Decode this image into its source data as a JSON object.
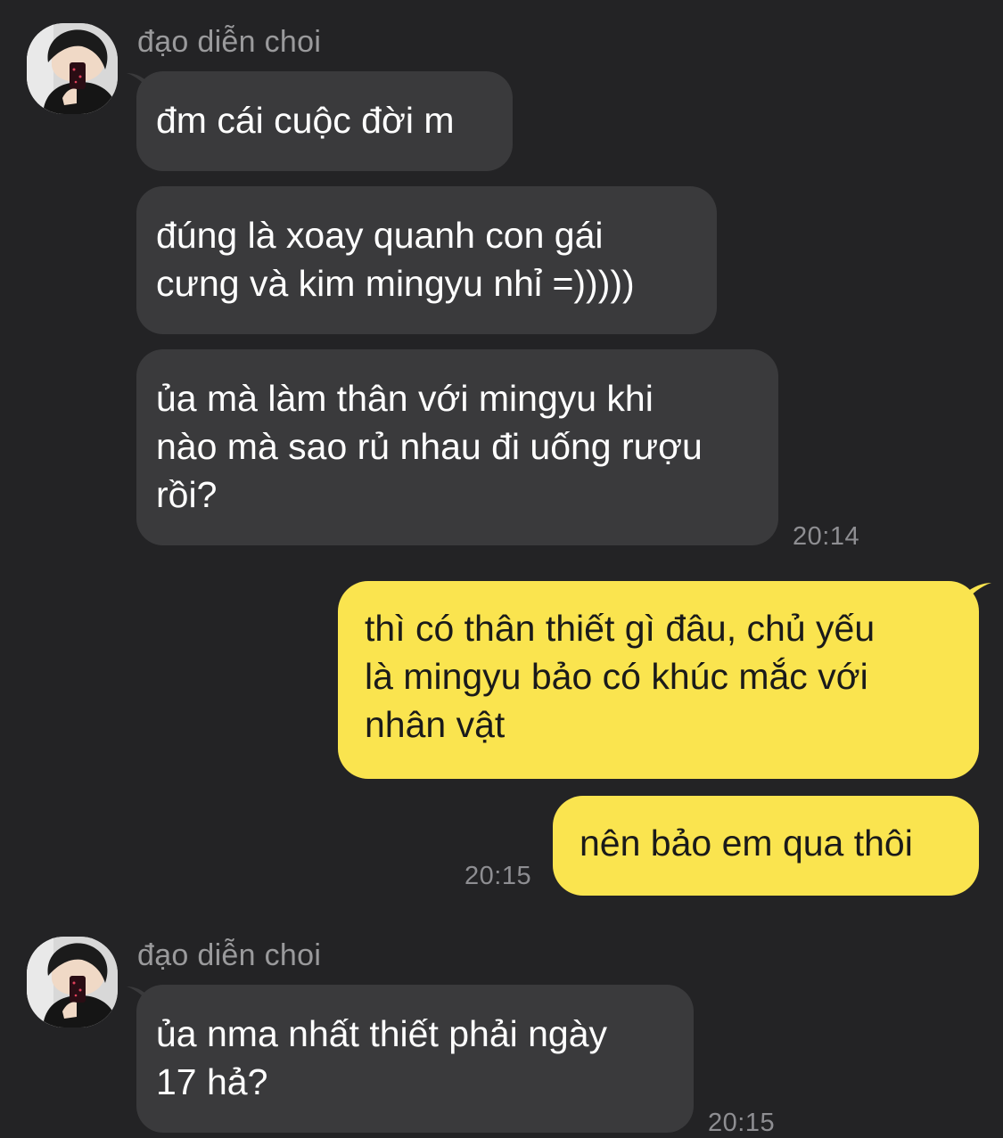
{
  "conversation": {
    "groups": [
      {
        "sender": "đạo diễn choi",
        "messages": [
          "đm cái cuộc đời m",
          "đúng là xoay quanh con gái\ncưng và kim mingyu nhỉ =)))))",
          "ủa mà làm thân với mingyu khi\nnào mà sao rủ nhau đi uống rượu\nrồi?"
        ],
        "time": "20:14"
      },
      {
        "sender": "me",
        "messages": [
          "thì có thân thiết gì đâu, chủ yếu\nlà mingyu bảo có khúc mắc với\nnhân vật",
          "nên bảo em qua thôi"
        ],
        "time": "20:15"
      },
      {
        "sender": "đạo diễn choi",
        "messages": [
          "ủa nma nhất thiết phải ngày\n17 hả?"
        ],
        "time": "20:15"
      }
    ]
  },
  "colors": {
    "background": "#232325",
    "incoming_bubble": "#3a3a3c",
    "outgoing_bubble": "#fae44f",
    "timestamp": "#8e8e92",
    "sender_name": "#9a9a9c"
  }
}
